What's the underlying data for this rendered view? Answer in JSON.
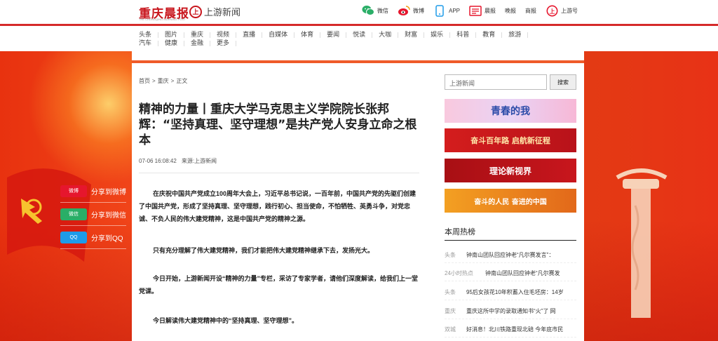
{
  "header": {
    "logo_main": "重庆晨报",
    "logo_sub": "THE CHONGQING MORNING POST",
    "logo2_mark": "上",
    "logo2_text": "上游新闻",
    "links": [
      {
        "label": "微信",
        "icon": "wechat-icon"
      },
      {
        "label": "微博",
        "icon": "weibo-icon"
      },
      {
        "label": "APP",
        "icon": "phone-icon"
      },
      {
        "label": "晨报",
        "icon": "newspaper-icon"
      },
      {
        "label": "晚报",
        "icon": ""
      },
      {
        "label": "商报",
        "icon": ""
      },
      {
        "label": "上游号",
        "icon": "shangyou-icon"
      }
    ]
  },
  "nav": {
    "items": [
      "头条",
      "图片",
      "重庆",
      "视频",
      "直播",
      "自媒体",
      "体育",
      "要闻",
      "悦读",
      "大咖",
      "财富",
      "娱乐",
      "科普",
      "教育",
      "旅游",
      "汽车",
      "健康",
      "金融",
      "更多"
    ]
  },
  "breadcrumb": [
    "首页",
    ">",
    "重庆",
    ">",
    "正文"
  ],
  "article": {
    "title": "精神的力量丨重庆大学马克思主义学院院长张邦辉：“坚持真理、坚守理想”是共产党人安身立命之根本",
    "time": "07-06 16:08:42",
    "source": "来源:上游新闻",
    "paragraphs": [
      "在庆祝中国共产党成立100周年大会上，习近平总书记说，一百年前，中国共产党的先驱们创建了中国共产党，形成了坚持真理、坚守理想，践行初心、担当使命，不怕牺牲、英勇斗争，对党忠诚、不负人民的伟大建党精神，这是中国共产党的精神之源。",
      "只有充分理解了伟大建党精神，我们才能把伟大建党精神继承下去，发扬光大。",
      "今日开始，上游新闻开设“精神的力量”专栏，采访了专家学者，请他们深度解读，给我们上一堂党课。",
      "今日解读伟大建党精神中的“坚持真理、坚守理想”。"
    ]
  },
  "share": [
    {
      "btn": "微博",
      "label": "分享到微博",
      "color": "#e6162d",
      "icon": "weibo-icon"
    },
    {
      "btn": "微信",
      "label": "分享到微信",
      "color": "#2aae67",
      "icon": "wechat-icon"
    },
    {
      "btn": "QQ",
      "label": "分享到QQ",
      "color": "#1e9be9",
      "icon": "qq-icon"
    }
  ],
  "sidebar": {
    "search_placeholder": "上游新闻",
    "search_button": "搜索",
    "banners": [
      {
        "text": "青春的我",
        "bg": "#f7b8d6",
        "fg": "#2a4aa8"
      },
      {
        "text": "奋斗百年路 启航新征程",
        "bg": "#c8161d",
        "fg": "#ffe7a8"
      },
      {
        "text": "理论新视界",
        "bg": "#b8121a",
        "fg": "#ffffff"
      },
      {
        "text": "奋斗的人民 奋进的中国",
        "bg": "#e07a12",
        "fg": "#ffffff"
      }
    ],
    "hot_title": "本周热榜",
    "hot_list": [
      {
        "tag": "头条",
        "text": "钟南山团队回应钟老“凡尔赛发言”："
      },
      {
        "tag": "24小时热点",
        "text": "钟南山团队回应钟老“凡尔赛发"
      },
      {
        "tag": "头条",
        "text": "95后女孩花10年积蓄入住毛坯房：14岁"
      },
      {
        "tag": "重庆",
        "text": "重庆这所中学的录取通知书“火”了 网"
      },
      {
        "tag": "双城",
        "text": "好消息！北川铁路重现北碚 今年底市民"
      }
    ]
  }
}
